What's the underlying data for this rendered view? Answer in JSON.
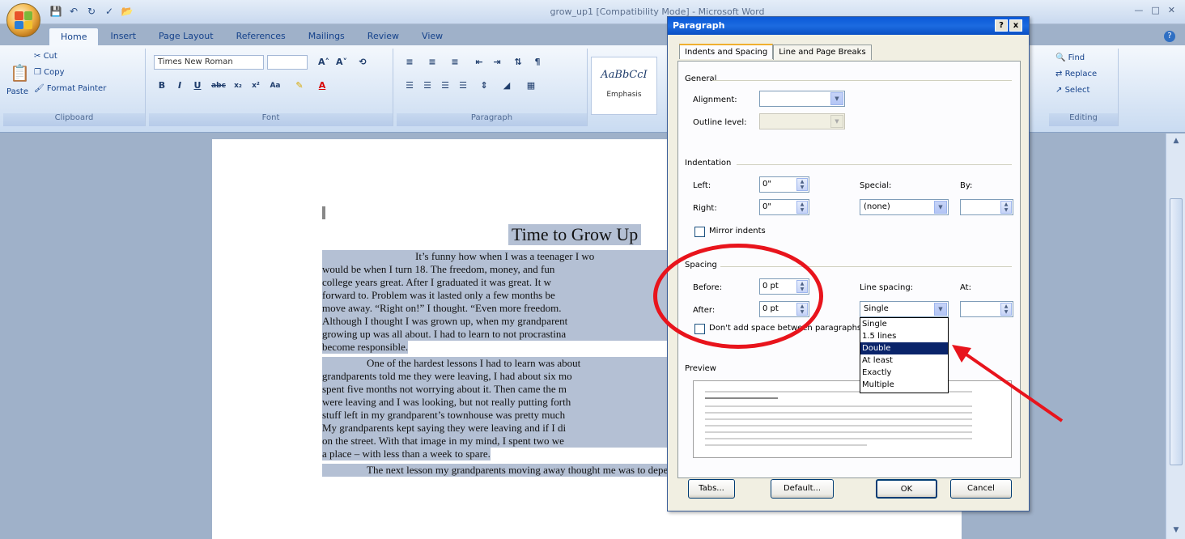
{
  "window": {
    "title": "grow_up1 [Compatibility Mode] - Microsoft Word"
  },
  "quick_access": {
    "icons": [
      "save-icon",
      "undo-icon",
      "redo-icon",
      "spelling-icon",
      "open-icon"
    ]
  },
  "tabs": [
    {
      "label": "Home",
      "active": true
    },
    {
      "label": "Insert"
    },
    {
      "label": "Page Layout"
    },
    {
      "label": "References"
    },
    {
      "label": "Mailings"
    },
    {
      "label": "Review"
    },
    {
      "label": "View"
    }
  ],
  "ribbon": {
    "clipboard": {
      "label": "Clipboard",
      "paste": "Paste",
      "cut": "Cut",
      "copy": "Copy",
      "format_painter": "Format Painter"
    },
    "font": {
      "label": "Font",
      "font_name": "Times New Roman"
    },
    "paragraph": {
      "label": "Paragraph"
    },
    "styles": {
      "sample": "AaBbCcI",
      "name": "Emphasis"
    },
    "editing": {
      "label": "Editing",
      "find": "Find",
      "replace": "Replace",
      "select": "Select"
    }
  },
  "document": {
    "title": "Time to Grow Up",
    "lines": [
      "It’s funny how when I was a teenager I wo",
      "would be when I turn 18.  The freedom, money, and fun",
      "college years great.  After I graduated it was great.  It w",
      "forward to.  Problem was it lasted only a few months be",
      "move away.  “Right on!” I thought. “Even more freedom.",
      "Although I thought I was grown up, when my grandparent",
      "growing up was all about.  I had to learn to not procrastina",
      "become responsible.",
      "One of the hardest lessons I had to learn was about",
      "grandparents told me they were leaving, I had about six mo",
      "spent five months not worrying about it.  Then came the m",
      "were leaving and I was looking, but not really putting forth",
      "stuff left in my grandparent’s townhouse was pretty much",
      "My grandparents kept saying they were leaving and if I di",
      "on the street.  With that image in my mind, I spent two we",
      "a place – with less than a week to spare.",
      "The next lesson my grandparents moving away thought me was to depend on"
    ]
  },
  "dialog": {
    "title": "Paragraph",
    "help": "?",
    "close": "x",
    "tabs": [
      "Indents and Spacing",
      "Line and Page Breaks"
    ],
    "general": {
      "section": "General",
      "alignment_label": "Alignment:",
      "alignment_value": "",
      "outline_label": "Outline level:",
      "outline_value": ""
    },
    "indentation": {
      "section": "Indentation",
      "left_label": "Left:",
      "left_value": "0\"",
      "right_label": "Right:",
      "right_value": "0\"",
      "special_label": "Special:",
      "special_value": "(none)",
      "by_label": "By:",
      "by_value": "",
      "mirror_label": "Mirror indents"
    },
    "spacing": {
      "section": "Spacing",
      "before_label": "Before:",
      "before_value": "0 pt",
      "after_label": "After:",
      "after_value": "0 pt",
      "line_spacing_label": "Line spacing:",
      "line_spacing_value": "Single",
      "at_label": "At:",
      "at_value": "",
      "dont_add_label": "Don't add space between paragraphs",
      "options": [
        "Single",
        "1.5 lines",
        "Double",
        "At least",
        "Exactly",
        "Multiple"
      ],
      "highlighted_option": "Double"
    },
    "preview": {
      "section": "Preview"
    },
    "buttons": {
      "tabs": "Tabs...",
      "default": "Default...",
      "ok": "OK",
      "cancel": "Cancel"
    }
  },
  "colors": {
    "annotation": "#e8141c",
    "selection": "#b4c0d4",
    "dialog_title": "#0a58d8"
  }
}
